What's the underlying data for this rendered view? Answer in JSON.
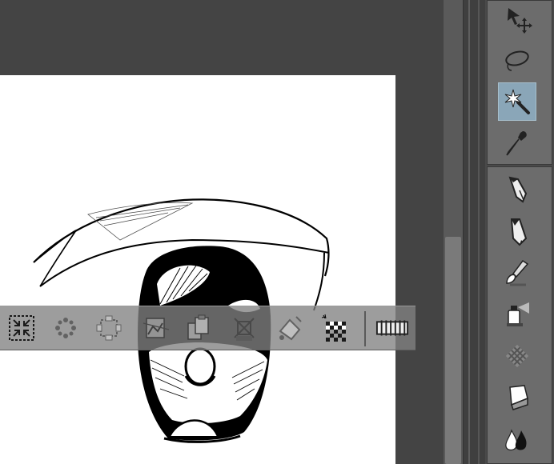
{
  "canvas": {
    "background": "#444444",
    "paper_color": "#ffffff",
    "artwork": "eye-sketch"
  },
  "selection_launcher": {
    "buttons": [
      {
        "icon": "shrink-selection-icon"
      },
      {
        "icon": "expand-points-icon"
      },
      {
        "icon": "scale-selection-icon"
      },
      {
        "icon": "transform-icon"
      },
      {
        "icon": "copy-paste-icon"
      },
      {
        "icon": "crop-icon"
      },
      {
        "icon": "fill-icon"
      },
      {
        "icon": "clear-transparent-icon"
      },
      {
        "icon": "selection-edge-icon"
      }
    ]
  },
  "tools": {
    "active": "magic-wand",
    "group1": [
      "move-tool",
      "lasso-tool",
      "magic-wand-tool",
      "eyedropper-tool"
    ],
    "group2": [
      "pen-tool",
      "pencil-tool",
      "brush-tool",
      "airbrush-tool",
      "decoration-tool",
      "eraser-tool",
      "blend-tool"
    ],
    "active_color": "#8aa6b8"
  }
}
